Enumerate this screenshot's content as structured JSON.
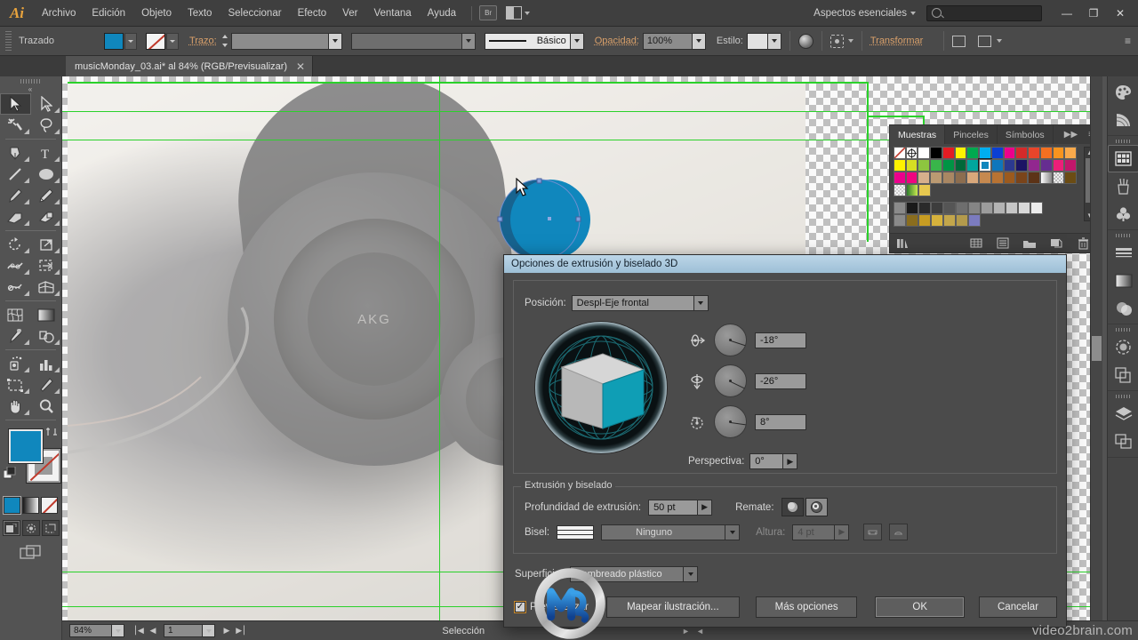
{
  "app": {
    "name": "Ai",
    "menus": [
      "Archivo",
      "Edición",
      "Objeto",
      "Texto",
      "Seleccionar",
      "Efecto",
      "Ver",
      "Ventana",
      "Ayuda"
    ],
    "bridge_label": "Br",
    "workspace": "Aspectos esenciales",
    "search_placeholder": "",
    "window_buttons": {
      "minimize": "—",
      "restore": "❐",
      "close": "✕"
    }
  },
  "controlbar": {
    "object_type": "Trazado",
    "fill_color": "#1087bd",
    "stroke_label": "Trazo:",
    "stroke_weight": "",
    "stroke_profile": "",
    "brush_label": "Básico",
    "opacity_label": "Opacidad:",
    "opacity_value": "100%",
    "style_label": "Estilo:",
    "transform_label": "Transformar"
  },
  "document": {
    "tab_title": "musicMonday_03.ai* al 84% (RGB/Previsualizar)",
    "tab_close": "✕"
  },
  "toolbar": {
    "tools": [
      {
        "name": "selection-tool",
        "label": "Selección",
        "active": true
      },
      {
        "name": "direct-selection-tool",
        "label": "Selección directa",
        "active": false
      },
      {
        "name": "magic-wand-tool",
        "label": "Varita mágica",
        "active": false
      },
      {
        "name": "lasso-tool",
        "label": "Lazo",
        "active": false
      },
      {
        "name": "pen-tool",
        "label": "Pluma",
        "active": false
      },
      {
        "name": "type-tool",
        "label": "Texto",
        "active": false
      },
      {
        "name": "line-segment-tool",
        "label": "Segmento de línea",
        "active": false
      },
      {
        "name": "ellipse-tool",
        "label": "Elipse",
        "active": false
      },
      {
        "name": "paintbrush-tool",
        "label": "Pincel",
        "active": false
      },
      {
        "name": "pencil-tool",
        "label": "Lápiz",
        "active": false
      },
      {
        "name": "blob-brush-tool",
        "label": "Pincel de manchas",
        "active": false
      },
      {
        "name": "eraser-tool",
        "label": "Borrador",
        "active": false
      },
      {
        "name": "rotate-tool",
        "label": "Rotar",
        "active": false
      },
      {
        "name": "scale-tool",
        "label": "Escala",
        "active": false
      },
      {
        "name": "width-tool",
        "label": "Anchura",
        "active": false
      },
      {
        "name": "free-transform-tool",
        "label": "Transformación libre",
        "active": false
      },
      {
        "name": "shape-builder-tool",
        "label": "Creador de formas",
        "active": false
      },
      {
        "name": "perspective-grid-tool",
        "label": "Cuadrícula de perspectiva",
        "active": false
      },
      {
        "name": "mesh-tool",
        "label": "Malla",
        "active": false
      },
      {
        "name": "gradient-tool",
        "label": "Degradado",
        "active": false
      },
      {
        "name": "eyedropper-tool",
        "label": "Cuentagotas",
        "active": false
      },
      {
        "name": "blend-tool",
        "label": "Fusión",
        "active": false
      },
      {
        "name": "symbol-sprayer-tool",
        "label": "Rociar símbolos",
        "active": false
      },
      {
        "name": "column-graph-tool",
        "label": "Gráfica de columnas",
        "active": false
      },
      {
        "name": "artboard-tool",
        "label": "Mesa de trabajo",
        "active": false
      },
      {
        "name": "slice-tool",
        "label": "Sector",
        "active": false
      },
      {
        "name": "hand-tool",
        "label": "Mano",
        "active": false
      },
      {
        "name": "zoom-tool",
        "label": "Zoom",
        "active": false
      }
    ],
    "fill_color": "#1087bd",
    "stroke_color": "none",
    "paint_modes": [
      "color-mode",
      "gradient-mode",
      "none-mode"
    ],
    "draw_modes": [
      "draw-normal",
      "draw-behind",
      "draw-inside"
    ],
    "screen_mode": "change-screen-mode"
  },
  "panels": {
    "tabs": [
      {
        "name": "muestras",
        "label": "Muestras",
        "active": true
      },
      {
        "name": "pinceles",
        "label": "Pinceles",
        "active": false
      },
      {
        "name": "simbolos",
        "label": "Símbolos",
        "active": false
      }
    ],
    "expand_icon": "▶▶",
    "menu_icon": "≡",
    "swatch_rows": [
      [
        "none",
        "registration",
        "#ffffff",
        "#000000",
        "#e31c23",
        "#fff200",
        "#00a94f",
        "#00aeef",
        "#0b3fd4",
        "#ec008c",
        "#d42a2a",
        "#e8452a",
        "#f37021",
        "#f7941e",
        "#f9a94b"
      ],
      [
        "#fff200",
        "#d7df23",
        "#8dc63f",
        "#39b54a",
        "#009444",
        "#006838",
        "#00a79d",
        "#1087bd",
        "#0e76bc",
        "#2b3990",
        "#1b1464",
        "#92278f",
        "#662d91",
        "#ed1e79",
        "#c1166b"
      ],
      [
        "#ec008c",
        "#f0047f",
        "#d6b08c",
        "#bb9a72",
        "#a98763",
        "#8c6d4f",
        "#d9a87b",
        "#c6894f",
        "#b87333",
        "#9c5a1e",
        "#7a441a",
        "#5c3317",
        "#f0f0f0",
        "#b0b0b0",
        "#6b4c14"
      ],
      [
        "#d8d8d8",
        "#c9c088",
        "#e6c84f",
        "",
        "",
        "",
        "",
        "",
        "",
        "",
        "",
        "",
        "",
        "",
        ""
      ],
      [
        "folder",
        "#1a1a1a",
        "#2a2a2a",
        "#3d3d3d",
        "#555555",
        "#6e6e6e",
        "#858585",
        "#9c9c9c",
        "#b3b3b3",
        "#c6c6c6",
        "#d9d9d9",
        "#ececec",
        "",
        "",
        ""
      ],
      [
        "folder",
        "#8a6d1e",
        "#c79c22",
        "#d6b23c",
        "#c3a64b",
        "#b39a4c",
        "#7b7bbf",
        "",
        "",
        "",
        "",
        "",
        "",
        "",
        ""
      ]
    ],
    "selected_swatch": {
      "row": 1,
      "col": 7,
      "color": "#1087bd"
    },
    "footer_icons": [
      "swatch-libraries-icon",
      "show-swatch-kinds-icon",
      "swatch-options-icon",
      "new-color-group-icon",
      "new-swatch-icon",
      "delete-swatch-icon"
    ],
    "dock_rail_icons": [
      "color-icon",
      "color-guide-icon",
      "swatches-icon",
      "brushes-icon",
      "symbols-icon",
      "stroke-icon",
      "gradient-icon",
      "transparency-icon",
      "appearance-icon",
      "graphic-styles-icon",
      "layers-icon",
      "artboards-icon"
    ]
  },
  "statusbar": {
    "zoom_value": "84%",
    "page_value": "1",
    "status_text": "Selección",
    "nav_first": "⎮◀",
    "nav_prev": "◀",
    "nav_next": "▶",
    "nav_last": "▶⎮"
  },
  "dialog": {
    "title": "Opciones de extrusión y biselado 3D",
    "position": {
      "label": "Posición:",
      "value": "Despl-Eje frontal"
    },
    "rotations": [
      {
        "name": "rotate-x",
        "value": "-18°",
        "needle_deg": 18
      },
      {
        "name": "rotate-y",
        "value": "-26°",
        "needle_deg": 26
      },
      {
        "name": "rotate-z",
        "value": "8°",
        "needle_deg": 8
      }
    ],
    "perspective": {
      "label": "Perspectiva:",
      "value": "0°"
    },
    "extrude_section": {
      "legend": "Extrusión y biselado",
      "depth_label": "Profundidad de extrusión:",
      "depth_value": "50 pt",
      "cap_label": "Remate:",
      "bevel_label": "Bisel:",
      "bevel_value": "Ninguno",
      "height_label": "Altura:",
      "height_value": "4 pt"
    },
    "surface": {
      "label": "Superficie:",
      "value": "Sombreado plástico"
    },
    "preview": {
      "label": "Previsualizar",
      "checked": true,
      "check_glyph": "✓"
    },
    "buttons": [
      {
        "name": "map-artwork-button",
        "label": "Mapear ilustración..."
      },
      {
        "name": "more-options-button",
        "label": "Más opciones"
      },
      {
        "name": "ok-button",
        "label": "OK"
      },
      {
        "name": "cancel-button",
        "label": "Cancelar"
      }
    ],
    "cube_colors": {
      "front": "#0f9eb5",
      "top": "#d6d6d6",
      "side": "#b8b8b8",
      "grid": "#1d6f77"
    }
  },
  "watermark": {
    "text_bold": "video2brain",
    "text_suffix": ".com"
  }
}
